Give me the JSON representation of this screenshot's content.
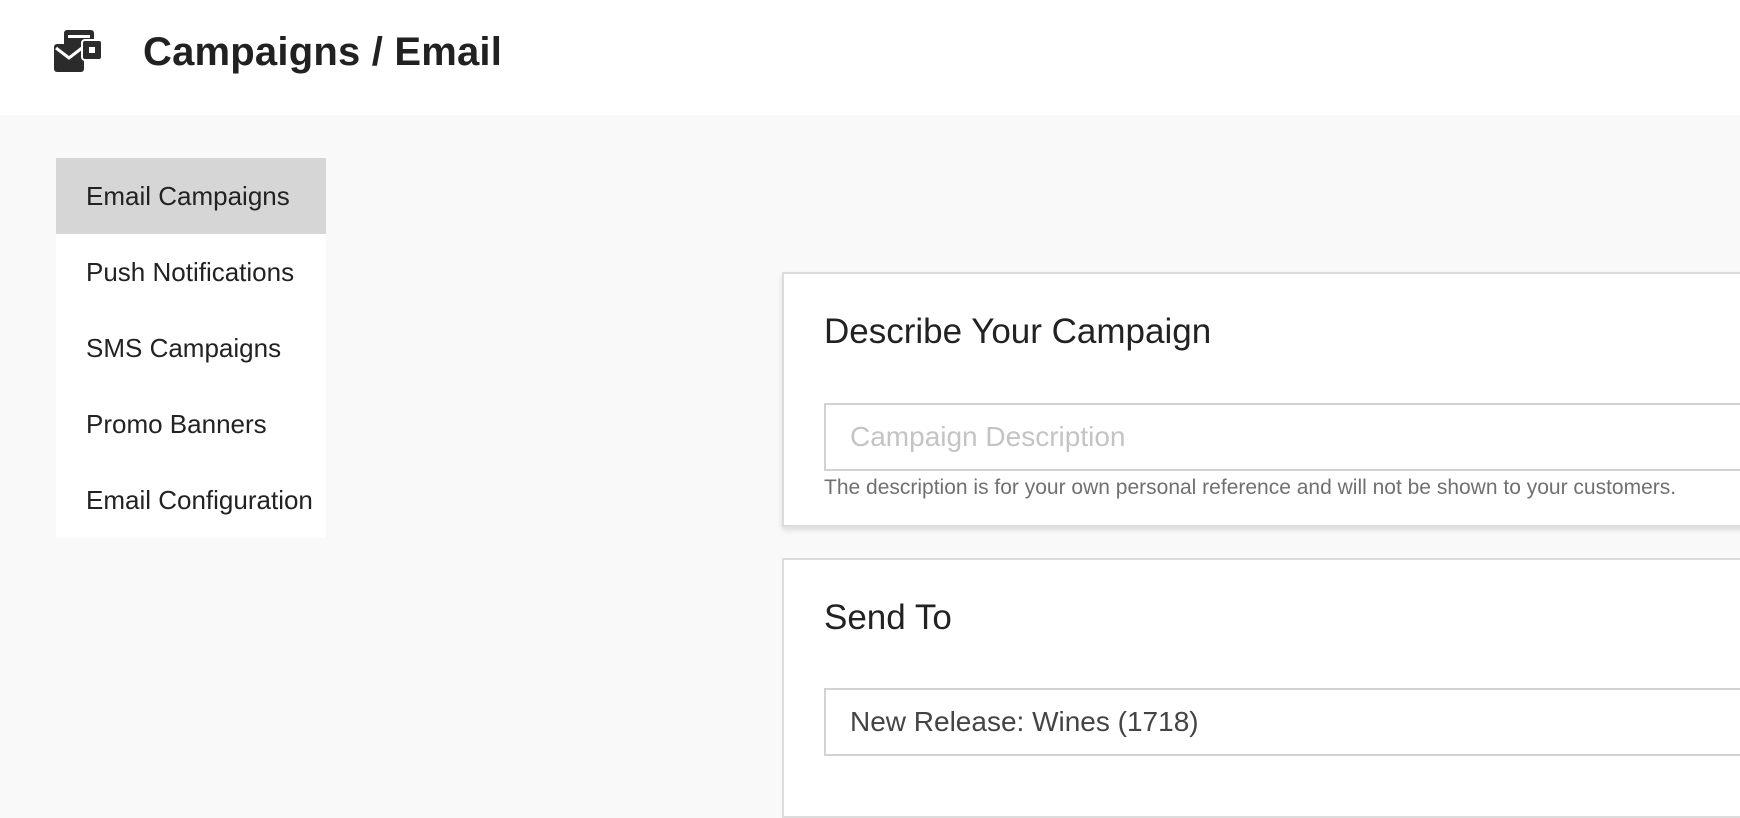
{
  "header": {
    "icon": "campaign-envelopes-icon",
    "title": "Campaigns / Email"
  },
  "sidebar": {
    "items": [
      {
        "label": "Email Campaigns",
        "active": true
      },
      {
        "label": "Push Notifications",
        "active": false
      },
      {
        "label": "SMS Campaigns",
        "active": false
      },
      {
        "label": "Promo Banners",
        "active": false
      },
      {
        "label": "Email Configuration",
        "active": false
      }
    ]
  },
  "describe": {
    "title": "Describe Your Campaign",
    "description_value": "",
    "description_placeholder": "Campaign Description",
    "help_text": "The description is for your own personal reference and will not be shown to your customers."
  },
  "send_to": {
    "title": "Send To",
    "selected": "New Release: Wines (1718)"
  },
  "colors": {
    "page_background": "#f9f9f9",
    "header_background": "#ffffff",
    "active_nav": "#d6d6d6",
    "card_border": "#dcdcdc"
  }
}
